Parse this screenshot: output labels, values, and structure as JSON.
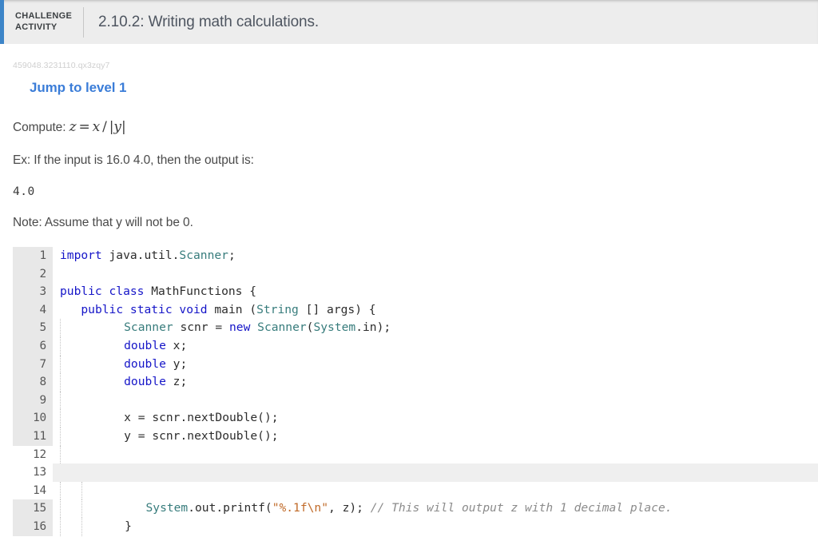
{
  "header": {
    "badge_line1": "CHALLENGE",
    "badge_line2": "ACTIVITY",
    "title": "2.10.2: Writing math calculations.",
    "accent_color": "#3d85c8",
    "background": "#ededed"
  },
  "activity": {
    "challenge_id": "459048.3231110.qx3zqy7",
    "jump_link": "Jump to level 1",
    "jump_link_color": "#3b7dd8",
    "compute_prefix": "Compute:",
    "formula": {
      "z": "z",
      "equals": "=",
      "numerator": "x",
      "slash": "/",
      "abs_open": "|",
      "denominator": "y",
      "abs_close": "|",
      "plain": "z = x/|y|"
    },
    "example_line": "Ex: If the input is 16.0 4.0, then the output is:",
    "example_output": "4.0",
    "note_line": "Note: Assume that y will not be 0."
  },
  "editor": {
    "language": "java",
    "active_line": 13,
    "editable_lines": [
      12,
      13,
      14
    ],
    "colors": {
      "keyword": "#1515c8",
      "type": "#377c7c",
      "string": "#c06a28",
      "comment": "#8b8b8b",
      "plain": "#2c2c2c",
      "gutter_bg": "#e8e8e8",
      "active_line_bg": "#efefef"
    },
    "lines": [
      {
        "n": "1",
        "indent": 0,
        "text": "import java.util.Scanner;"
      },
      {
        "n": "2",
        "indent": 0,
        "text": ""
      },
      {
        "n": "3",
        "indent": 0,
        "text": "public class MathFunctions {"
      },
      {
        "n": "4",
        "indent": 0,
        "text": "   public static void main (String [] args) {"
      },
      {
        "n": "5",
        "indent": 1,
        "text": "      Scanner scnr = new Scanner(System.in);"
      },
      {
        "n": "6",
        "indent": 1,
        "text": "      double x;"
      },
      {
        "n": "7",
        "indent": 1,
        "text": "      double y;"
      },
      {
        "n": "8",
        "indent": 1,
        "text": "      double z;"
      },
      {
        "n": "9",
        "indent": 1,
        "text": ""
      },
      {
        "n": "10",
        "indent": 1,
        "text": "      x = scnr.nextDouble();"
      },
      {
        "n": "11",
        "indent": 1,
        "text": "      y = scnr.nextDouble();"
      },
      {
        "n": "12",
        "indent": 1,
        "text": ""
      },
      {
        "n": "13",
        "indent": 0,
        "text": ""
      },
      {
        "n": "14",
        "indent": 2,
        "text": ""
      },
      {
        "n": "15",
        "indent": 2,
        "text": "      System.out.printf(\"%.1f\\n\", z); // This will output z with 1 decimal place."
      },
      {
        "n": "16",
        "indent": 2,
        "text": "   }"
      }
    ]
  }
}
